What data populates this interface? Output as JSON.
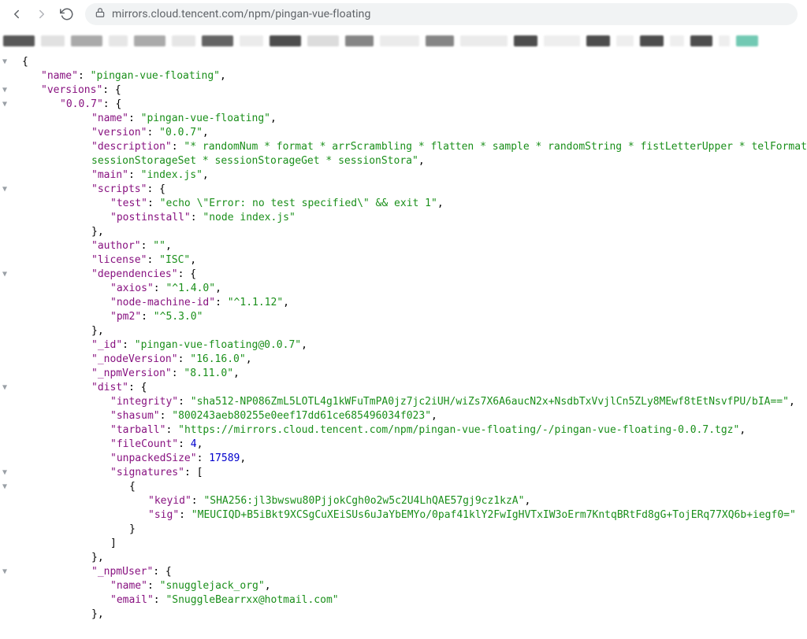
{
  "url": "mirrors.cloud.tencent.com/npm/pingan-vue-floating",
  "json": {
    "name": "pingan-vue-floating",
    "versions_key": "versions",
    "version_key": "0.0.7",
    "v": {
      "name": "pingan-vue-floating",
      "version": "0.0.7",
      "description_line1": "* randomNum * format * arrScrambling * flatten * sample * randomString * fistLetterUpper * telFormat * getKeba",
      "description_line2": "sessionStorageSet * sessionStorageGet * sessionStora",
      "main": "index.js",
      "scripts": {
        "test": "echo \\\"Error: no test specified\\\" && exit 1",
        "postinstall": "node index.js"
      },
      "author": "",
      "license": "ISC",
      "dependencies": {
        "axios": "^1.4.0",
        "node_machine_id": "^1.1.12",
        "pm2": "^5.3.0"
      },
      "id": "pingan-vue-floating@0.0.7",
      "nodeVersion": "16.16.0",
      "npmVersion": "8.11.0",
      "dist": {
        "integrity": "sha512-NP086ZmL5LOTL4g1kWFuTmPA0jz7jc2iUH/wiZs7X6A6aucN2x+NsdbTxVvjlCn5ZLy8MEwf8tEtNsvfPU/bIA==",
        "shasum": "800243aeb80255e0eef17dd61ce685496034f023",
        "tarball": "https://mirrors.cloud.tencent.com/npm/pingan-vue-floating/-/pingan-vue-floating-0.0.7.tgz",
        "fileCount": "4",
        "unpackedSize": "17589",
        "sig": {
          "keyid": "SHA256:jl3bwswu80PjjokCgh0o2w5c2U4LhQAE57gj9cz1kzA",
          "sig": "MEUCIQD+B5iBkt9XCSgCuXEiSUs6uJaYbEMYo/0paf41klY2FwIgHVTxIW3oErm7KntqBRtFd8gG+TojERq77XQ6b+iegf0="
        }
      },
      "npmUser": {
        "name": "snugglejack_org",
        "email": "SnuggleBearrxx@hotmail.com"
      }
    }
  },
  "labels": {
    "name": "name",
    "version": "version",
    "description": "description",
    "main": "main",
    "scripts": "scripts",
    "test": "test",
    "postinstall": "postinstall",
    "author": "author",
    "license": "license",
    "dependencies": "dependencies",
    "axios": "axios",
    "node_machine_id": "node-machine-id",
    "pm2": "pm2",
    "id": "_id",
    "nodeVersion": "_nodeVersion",
    "npmVersion": "_npmVersion",
    "dist": "dist",
    "integrity": "integrity",
    "shasum": "shasum",
    "tarball": "tarball",
    "fileCount": "fileCount",
    "unpackedSize": "unpackedSize",
    "signatures": "signatures",
    "keyid": "keyid",
    "sig": "sig",
    "npmUser": "_npmUser",
    "email": "email"
  }
}
